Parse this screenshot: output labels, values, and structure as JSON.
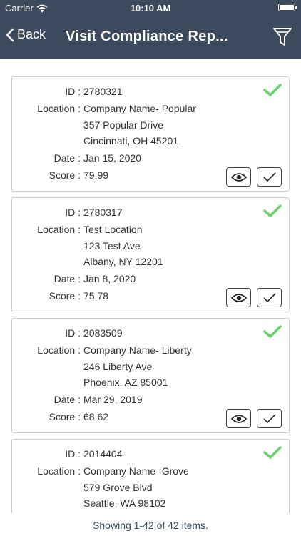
{
  "status_bar": {
    "carrier": "Carrier",
    "time": "10:10 AM"
  },
  "nav": {
    "back_label": "Back",
    "title": "Visit Compliance Rep..."
  },
  "labels": {
    "id": "ID :",
    "location": "Location :",
    "date": "Date :",
    "score": "Score :"
  },
  "colors": {
    "header_bg": "#3d4a5d",
    "check_green": "#6bd26b"
  },
  "reports": [
    {
      "id": "2780321",
      "location": [
        "Company Name- Popular",
        "357 Popular Drive",
        "Cincinnati, OH 45201"
      ],
      "date": "Jan 15, 2020",
      "score": "79.99"
    },
    {
      "id": "2780317",
      "location": [
        "Test Location",
        "123 Test Ave",
        "Albany, NY 12201"
      ],
      "date": "Jan 8, 2020",
      "score": "75.78"
    },
    {
      "id": "2083509",
      "location": [
        "Company Name- Liberty",
        "246 Liberty Ave",
        "Phoenix, AZ 85001"
      ],
      "date": "Mar 29, 2019",
      "score": "68.62"
    },
    {
      "id": "2014404",
      "location": [
        "Company Name- Grove",
        "579 Grove Blvd",
        "Seattle, WA 98102"
      ],
      "date": "",
      "score": ""
    }
  ],
  "footer": {
    "text": "Showing 1-42 of 42 items."
  }
}
